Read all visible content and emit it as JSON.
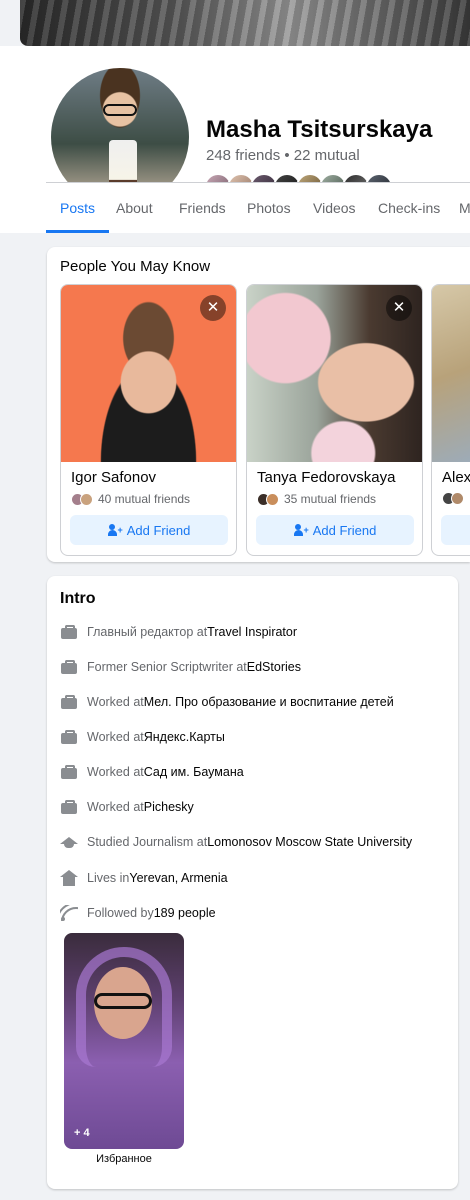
{
  "profile": {
    "name": "Masha Tsitsurskaya",
    "friends_line": "248 friends • 22 mutual"
  },
  "tabs": [
    "Posts",
    "About",
    "Friends",
    "Photos",
    "Videos",
    "Check-ins",
    "M"
  ],
  "active_tab": "Posts",
  "pymk": {
    "title": "People You May Know",
    "close_glyph": "✕",
    "add_label": "Add Friend",
    "people": [
      {
        "name": "Igor Safonov",
        "mutual": "40 mutual friends"
      },
      {
        "name": "Tanya Fedorovskaya",
        "mutual": "35 mutual friends"
      },
      {
        "name": "Alex",
        "mutual": ""
      }
    ]
  },
  "intro": {
    "title": "Intro",
    "items": [
      {
        "icon": "briefcase-icon",
        "pre": "Главный редактор at ",
        "strong": "Travel Inspirator"
      },
      {
        "icon": "briefcase-icon",
        "pre": "Former Senior Scriptwriter at ",
        "strong": "EdStories"
      },
      {
        "icon": "briefcase-icon",
        "pre": "Worked at ",
        "strong": "Мел. Про образование и воспитание детей"
      },
      {
        "icon": "briefcase-icon",
        "pre": "Worked at ",
        "strong": "Яндекс.Карты"
      },
      {
        "icon": "briefcase-icon",
        "pre": "Worked at ",
        "strong": "Сад им. Баумана"
      },
      {
        "icon": "briefcase-icon",
        "pre": "Worked at ",
        "strong": "Pichesky"
      },
      {
        "icon": "graduation-cap-icon",
        "pre": "Studied Journalism at ",
        "strong": "Lomonosov Moscow State University"
      },
      {
        "icon": "home-icon",
        "pre": "Lives in ",
        "strong": "Yerevan, Armenia"
      },
      {
        "icon": "rss-icon",
        "pre": "Followed by ",
        "strong": "189 people"
      }
    ],
    "featured": {
      "count": "+ 4",
      "label": "Избранное"
    }
  },
  "colors": {
    "accent": "#1877f2",
    "secondary_text": "#65676b",
    "background": "#f0f2f5"
  }
}
